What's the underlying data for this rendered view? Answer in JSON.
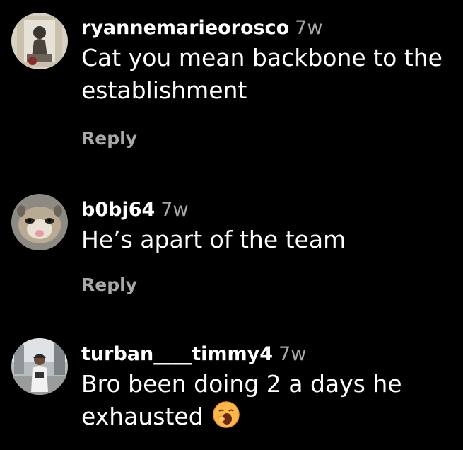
{
  "comments": [
    {
      "username": "ryannemarieorosco",
      "time": "7w",
      "text": "Cat you mean backbone to the establishment",
      "reply_label": "Reply",
      "avatar_icon": "vintage-photo-avatar"
    },
    {
      "username": "b0bj64",
      "time": "7w",
      "text": "He’s apart of the team",
      "reply_label": "Reply",
      "avatar_icon": "ferret-avatar"
    },
    {
      "username": "turban____timmy4",
      "time": "7w",
      "text": "Bro been doing 2 a days he exhausted",
      "emoji": "yawning-face-emoji",
      "avatar_icon": "street-photo-avatar"
    }
  ],
  "colors": {
    "background": "#000000",
    "primary_text": "#ffffff",
    "secondary_text": "#a8a8a8"
  }
}
